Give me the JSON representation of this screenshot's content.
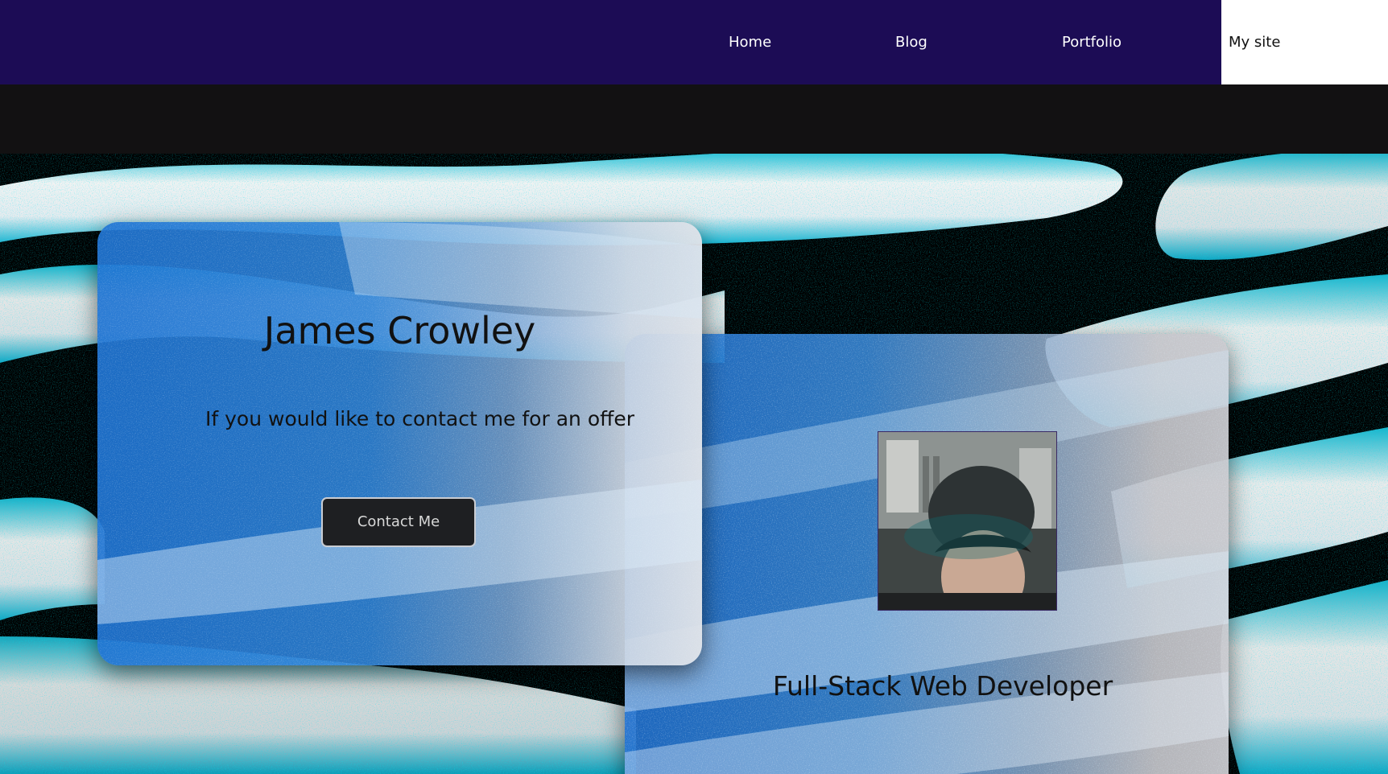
{
  "nav": {
    "home_label": "Home",
    "blog_label": "Blog",
    "portfolio_label": "Portfolio",
    "site_label": "My site"
  },
  "hero": {
    "name": "James Crowley",
    "tagline": "If you would like to contact me for an offer",
    "contact_button": "Contact Me",
    "role": "Full-Stack Web Developer",
    "photo_icon": "profile-photo"
  },
  "colors": {
    "navbar": "#1c0c55",
    "band": "#121112",
    "card_blue": "#1e6ecd",
    "accent_cyan": "#12c8e0"
  }
}
